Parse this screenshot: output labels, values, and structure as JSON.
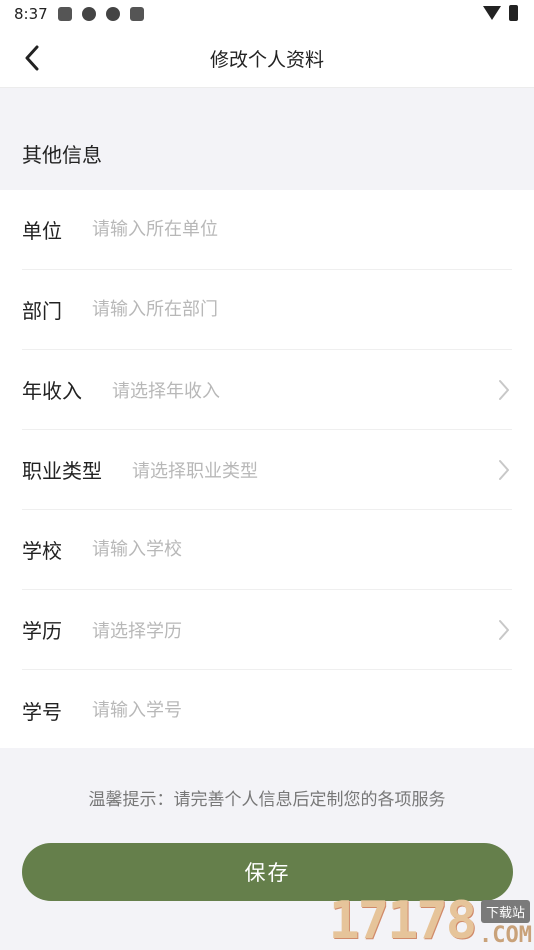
{
  "status_bar": {
    "time": "8:37",
    "icons": [
      "mail-icon",
      "app-icon",
      "app-icon",
      "a-icon"
    ],
    "right_icons": [
      "wifi-icon",
      "battery-icon"
    ]
  },
  "header": {
    "title": "修改个人资料",
    "back_icon": "chevron-left-icon"
  },
  "section": {
    "title": "其他信息"
  },
  "form": {
    "rows": [
      {
        "label": "单位",
        "placeholder": "请输入所在单位",
        "type": "input"
      },
      {
        "label": "部门",
        "placeholder": "请输入所在部门",
        "type": "input"
      },
      {
        "label": "年收入",
        "placeholder": "请选择年收入",
        "type": "select"
      },
      {
        "label": "职业类型",
        "placeholder": "请选择职业类型",
        "type": "select"
      },
      {
        "label": "学校",
        "placeholder": "请输入学校",
        "type": "input"
      },
      {
        "label": "学历",
        "placeholder": "请选择学历",
        "type": "select"
      },
      {
        "label": "学号",
        "placeholder": "请输入学号",
        "type": "input"
      }
    ]
  },
  "tip": "温馨提示：请完善个人信息后定制您的各项服务",
  "save_label": "保存",
  "watermark": {
    "digits": "17178",
    "badge": "下载站",
    "com": ".COM"
  },
  "colors": {
    "accent": "#657f4b",
    "placeholder": "#b8b8b8",
    "background": "#f3f3f7"
  }
}
